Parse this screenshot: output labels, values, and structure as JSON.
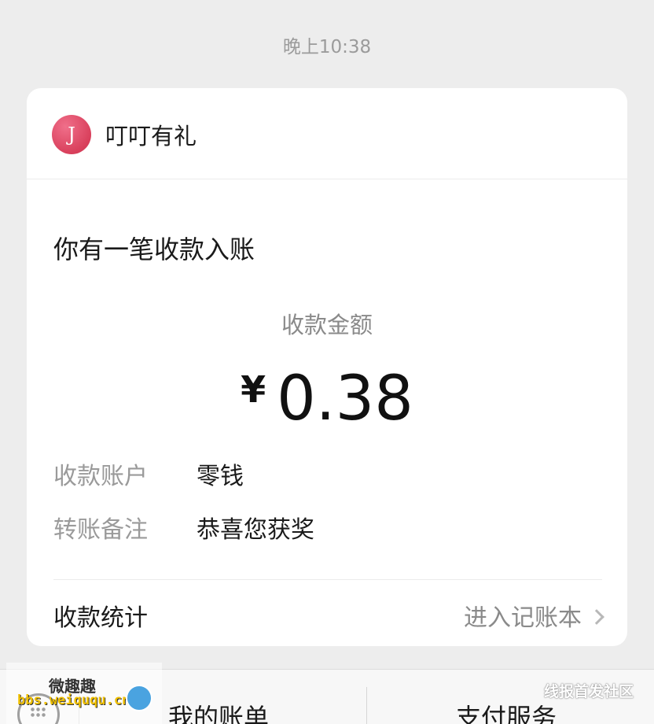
{
  "timestamp": "晚上10:38",
  "card": {
    "sender": {
      "avatar_glyph": "J",
      "name": "叮叮有礼"
    },
    "title": "你有一笔收款入账",
    "amount_label": "收款金额",
    "currency": "¥",
    "amount": "0.38",
    "details": [
      {
        "key": "收款账户",
        "value": "零钱"
      },
      {
        "key": "转账备注",
        "value": "恭喜您获奖"
      }
    ],
    "stats_label": "收款统计",
    "ledger_link": "进入记账本"
  },
  "bottom_menu": {
    "items": [
      "我的账单",
      "支付服务"
    ]
  },
  "watermarks": {
    "left_line1": "微趣趣",
    "left_line2": "bbs.weiququ.cn",
    "right": "线报首发社区"
  },
  "colors": {
    "background": "#ededed",
    "card": "#ffffff",
    "avatar": "#d9405c"
  }
}
